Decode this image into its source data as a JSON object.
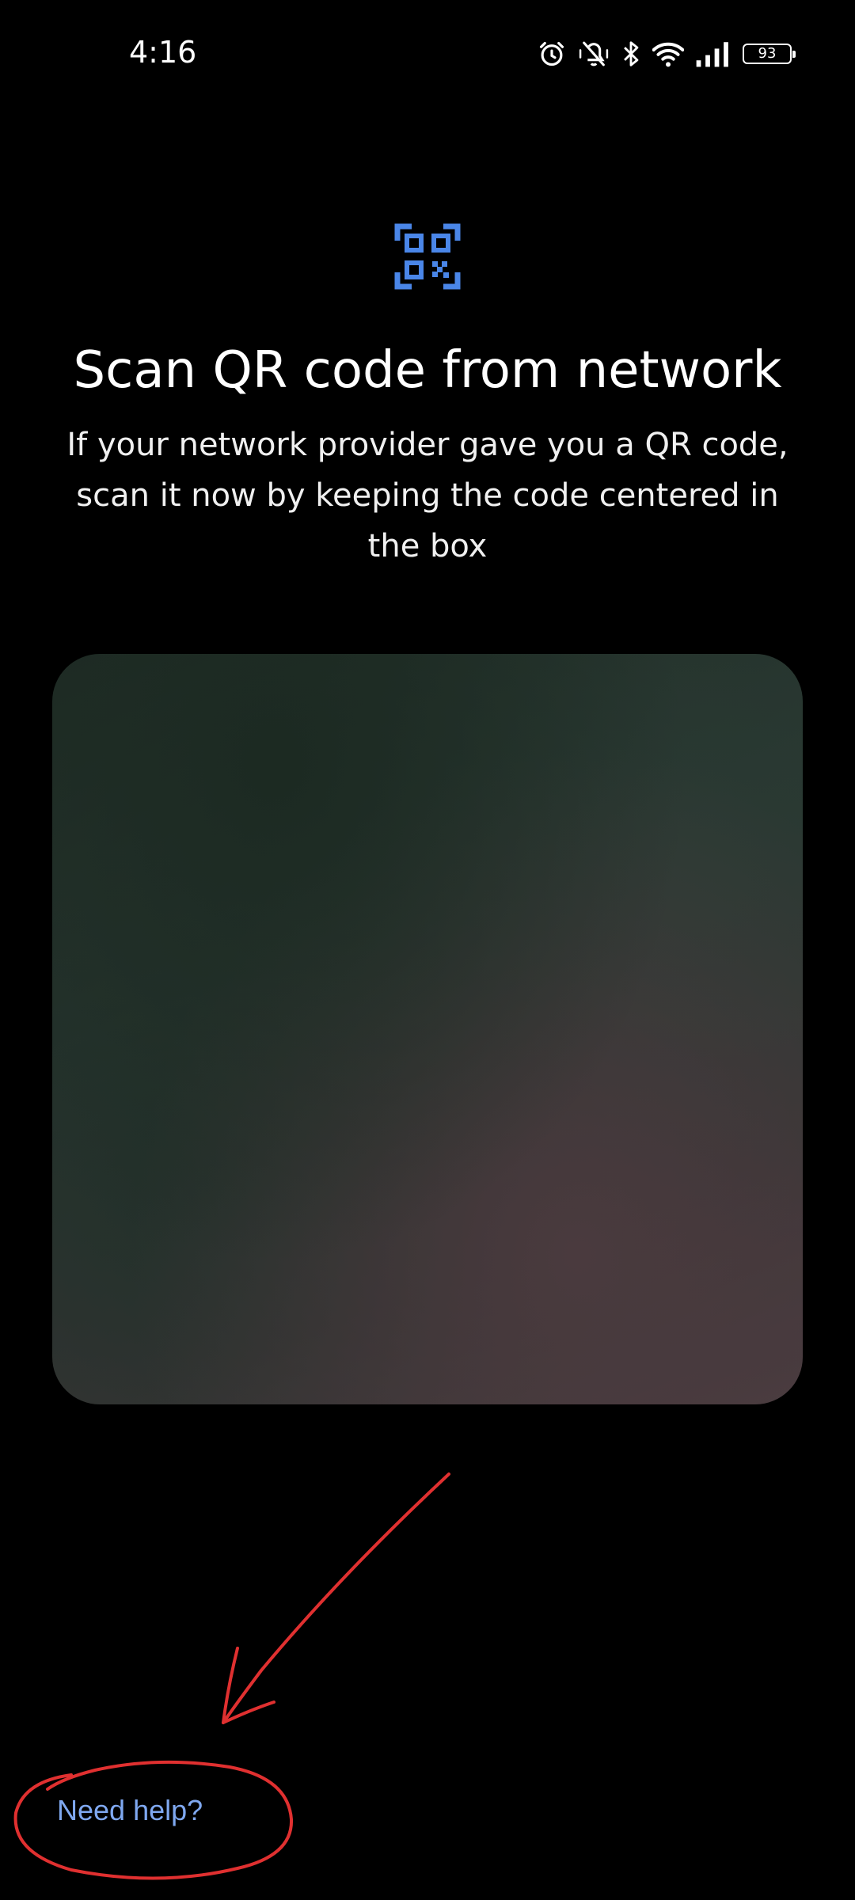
{
  "status_bar": {
    "time": "4:16",
    "icons": [
      "alarm-icon",
      "vibrate-off-icon",
      "bluetooth-icon",
      "wifi-icon",
      "cellular-signal-icon",
      "battery-icon"
    ],
    "battery_level": "93"
  },
  "screen": {
    "icon": "qr-code-scanner-icon",
    "title": "Scan QR code from network",
    "subtitle": "If your network provider gave you a QR code, scan it now by keeping the code centered in the box"
  },
  "footer": {
    "help_link": "Need help?"
  },
  "colors": {
    "background": "#000000",
    "accent": "#4a86e8",
    "link": "#7fa8f0",
    "annotation": "#e03030"
  }
}
